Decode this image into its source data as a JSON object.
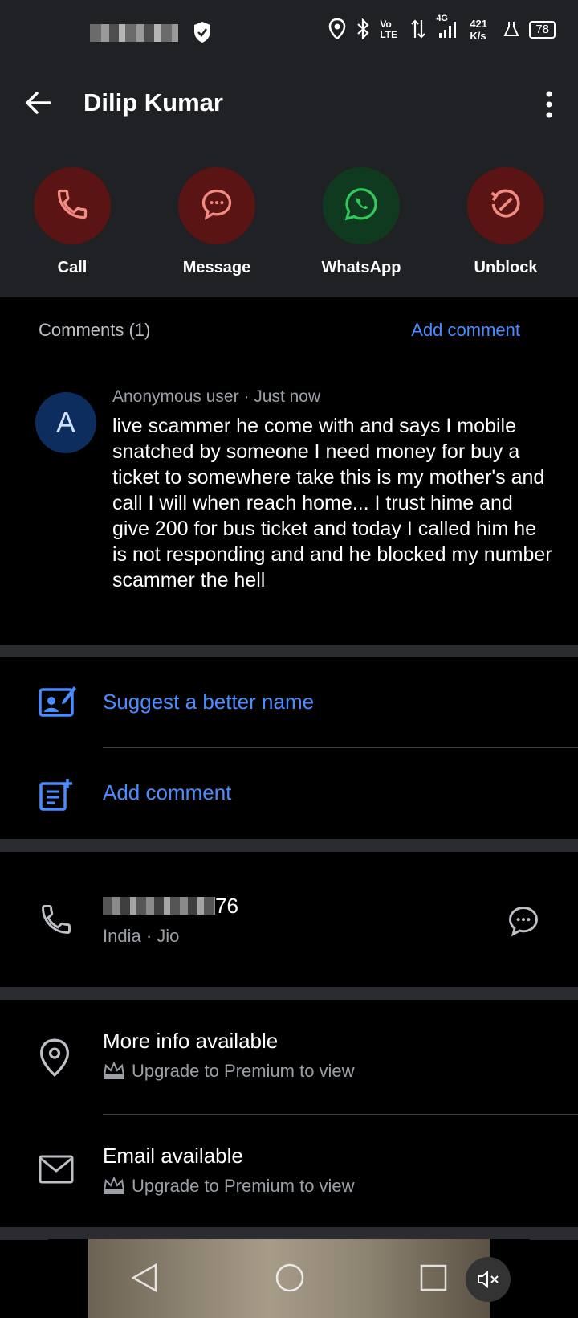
{
  "status_bar": {
    "net_speed": "421 K/s",
    "network": "4G",
    "volte": "Vo LTE",
    "battery": "78"
  },
  "header": {
    "title": "Dilip Kumar",
    "actions": [
      {
        "label": "Call",
        "icon": "phone-icon",
        "color": "#5a1414",
        "icon_color": "#f28b82"
      },
      {
        "label": "Message",
        "icon": "chat-bubble-icon",
        "color": "#5a1414",
        "icon_color": "#f28b82"
      },
      {
        "label": "WhatsApp",
        "icon": "whatsapp-icon",
        "color": "#0f3a1f",
        "icon_color": "#34c759"
      },
      {
        "label": "Unblock",
        "icon": "unblock-icon",
        "color": "#5a1414",
        "icon_color": "#f28b82"
      }
    ]
  },
  "comments": {
    "count_label": "Comments (1)",
    "add_label": "Add comment",
    "items": [
      {
        "avatar_letter": "A",
        "author": "Anonymous user",
        "time": "Just now",
        "text": "live scammer he come with and says I mobile snatched by someone I need money for buy a ticket to somewhere take this is my mother's and call I will when reach home... I trust hime and give 200 for bus ticket and today I called him he is not responding and and he blocked my number scammer the hell"
      }
    ]
  },
  "suggest": {
    "suggest_label": "Suggest a better name",
    "add_comment_label": "Add comment"
  },
  "phone": {
    "number_suffix": "76",
    "details": "India · Jio"
  },
  "info": {
    "more_info": "More info available",
    "email": "Email available",
    "upgrade": "Upgrade to Premium to view"
  },
  "colors": {
    "accent": "#4a8cff",
    "header_bg": "#202124"
  }
}
